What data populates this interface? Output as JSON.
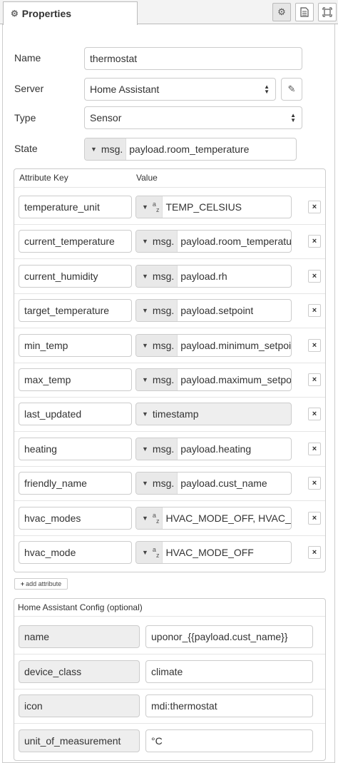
{
  "tab": {
    "title": "Properties",
    "icon": "gear-icon"
  },
  "toolbar": {
    "buttons": [
      {
        "icon": "gear-icon"
      },
      {
        "icon": "document-icon"
      },
      {
        "icon": "frame-icon"
      }
    ]
  },
  "form": {
    "name": {
      "label": "Name",
      "value": "thermostat"
    },
    "server": {
      "label": "Server",
      "value": "Home Assistant"
    },
    "type": {
      "label": "Type",
      "value": "Sensor"
    },
    "state": {
      "label": "State",
      "type": "msg.",
      "value": "payload.room_temperature"
    }
  },
  "attributes": {
    "header_key": "Attribute Key",
    "header_value": "Value",
    "rows": [
      {
        "key": "temperature_unit",
        "type": "az",
        "value": "TEMP_CELSIUS"
      },
      {
        "key": "current_temperature",
        "type": "msg.",
        "value": "payload.room_temperature"
      },
      {
        "key": "current_humidity",
        "type": "msg.",
        "value": "payload.rh"
      },
      {
        "key": "target_temperature",
        "type": "msg.",
        "value": "payload.setpoint"
      },
      {
        "key": "min_temp",
        "type": "msg.",
        "value": "payload.minimum_setpoint"
      },
      {
        "key": "max_temp",
        "type": "msg.",
        "value": "payload.maximum_setpoint"
      },
      {
        "key": "last_updated",
        "type": "timestamp",
        "value": ""
      },
      {
        "key": "heating",
        "type": "msg.",
        "value": "payload.heating"
      },
      {
        "key": "friendly_name",
        "type": "msg.",
        "value": "payload.cust_name"
      },
      {
        "key": "hvac_modes",
        "type": "az",
        "value": "HVAC_MODE_OFF, HVAC_MODE_HEAT"
      },
      {
        "key": "hvac_mode",
        "type": "az",
        "value": "HVAC_MODE_OFF"
      }
    ],
    "delete_label": "×",
    "add_label": "add attribute"
  },
  "ha_config": {
    "title": "Home Assistant Config (optional)",
    "rows": [
      {
        "key": "name",
        "value": "uponor_{{payload.cust_name}}"
      },
      {
        "key": "device_class",
        "value": "climate"
      },
      {
        "key": "icon",
        "value": "mdi:thermostat"
      },
      {
        "key": "unit_of_measurement",
        "value": "°C"
      }
    ]
  }
}
